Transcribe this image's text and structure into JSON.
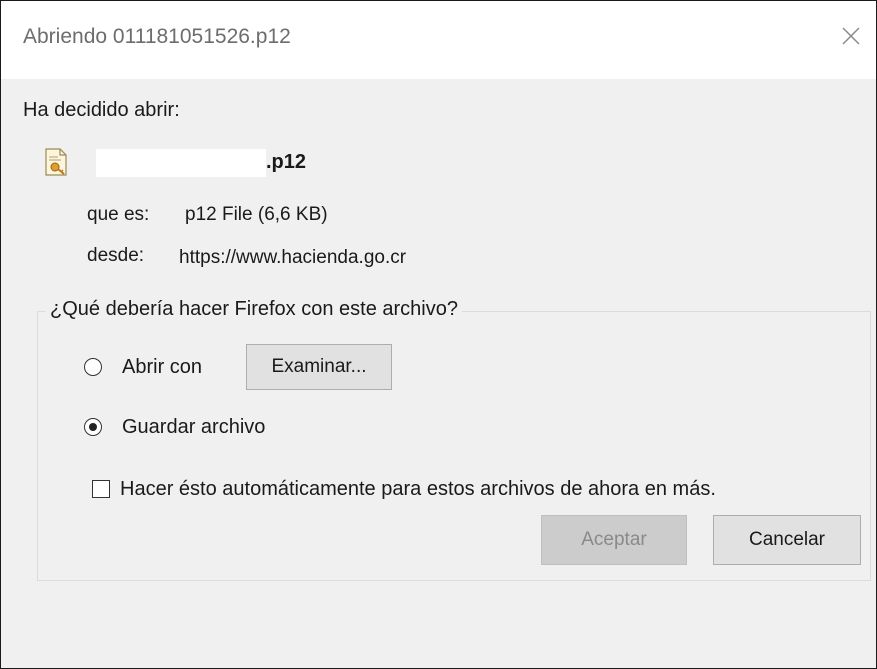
{
  "dialog": {
    "title": "Abriendo 011181051526.p12"
  },
  "info": {
    "heading": "Ha decidido abrir:",
    "file_name": ".p12",
    "type_label": "que es:",
    "type_value": "p12 File (6,6 KB)",
    "from_label": "desde:",
    "from_value": "https://www.hacienda.go.cr"
  },
  "action_group": {
    "legend": "¿Qué debería hacer Firefox con este archivo?",
    "open_with_label": "Abrir con",
    "browse_button": "Examinar...",
    "save_label": "Guardar archivo",
    "save_checked": true,
    "auto_label": "Hacer ésto automáticamente para estos archivos de ahora en más.",
    "auto_checked": false
  },
  "buttons": {
    "accept": "Aceptar",
    "cancel": "Cancelar"
  },
  "icons": {
    "close": "close-icon",
    "file": "certificate-file-icon"
  }
}
